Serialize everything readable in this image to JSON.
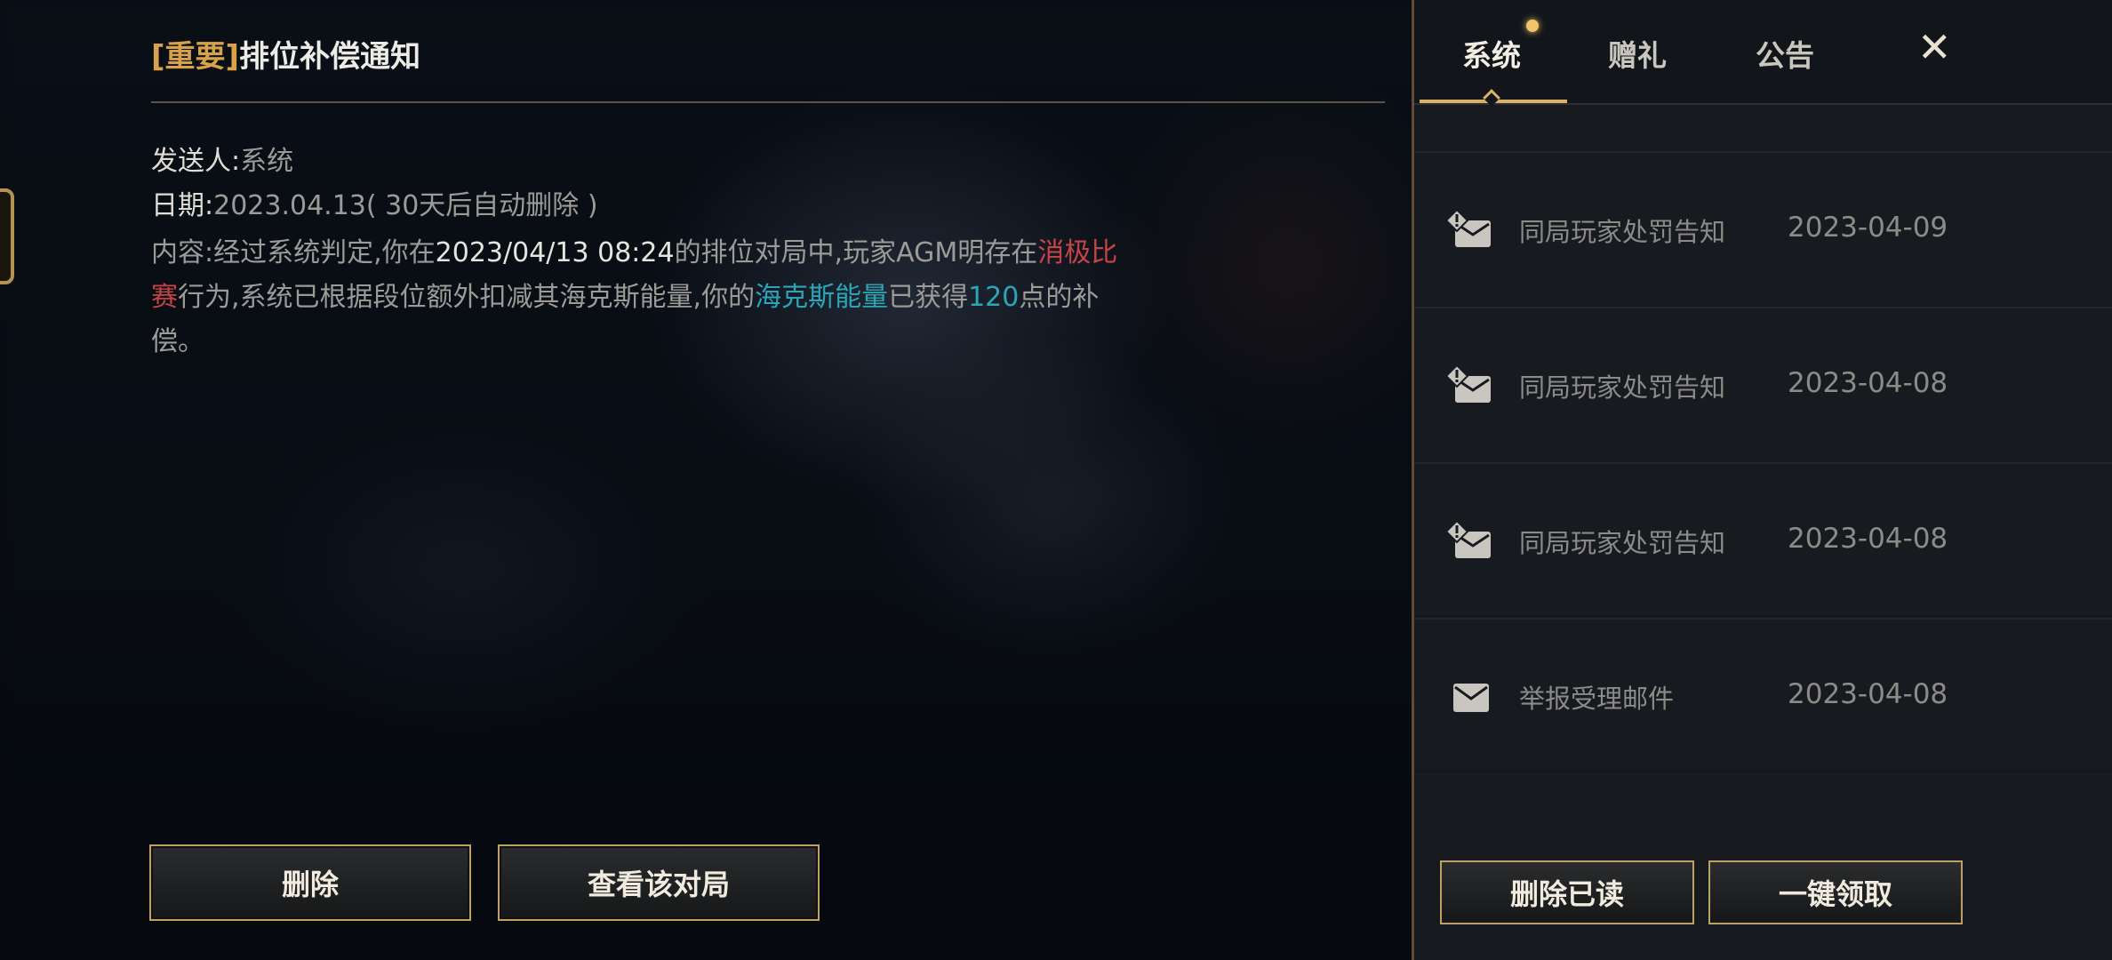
{
  "mail": {
    "tag": "[重要]",
    "title": "排位补偿通知",
    "sender_label": "发送人:",
    "sender": "系统",
    "date_label": "日期:",
    "date": "2023.04.13",
    "date_note": "( 30天后自动删除 )",
    "content_prefix": "内容:经过系统判定,你在",
    "content_time": "2023/04/13 08:24",
    "content_mid1": "的排位对局中,玩家AGM明存在",
    "content_red": "消极比赛",
    "content_mid2": "行为,系统已根据段位额外扣减其海克斯能量,你的",
    "content_cyan": "海克斯能量",
    "content_mid3": "已获得",
    "content_amount": "120",
    "content_suffix": "点的补偿。"
  },
  "buttons": {
    "delete": "删除",
    "view_match": "查看该对局",
    "delete_read": "删除已读",
    "claim_all": "一键领取"
  },
  "tabs": [
    "系统",
    "赠礼",
    "公告"
  ],
  "close": "✕",
  "side_id": "284469",
  "mail_list": [
    {
      "icon": "mail-warning-icon",
      "title": "同局玩家处罚告知",
      "date": "2023-04-09"
    },
    {
      "icon": "mail-warning-icon",
      "title": "同局玩家处罚告知",
      "date": "2023-04-08"
    },
    {
      "icon": "mail-warning-icon",
      "title": "同局玩家处罚告知",
      "date": "2023-04-08"
    },
    {
      "icon": "mail-icon",
      "title": "举报受理邮件",
      "date": "2023-04-08"
    }
  ],
  "colors": {
    "accent_gold": "#d7a24a",
    "highlight_red": "#c84344",
    "highlight_cyan": "#2aa6b8",
    "button_border": "#bda064"
  }
}
